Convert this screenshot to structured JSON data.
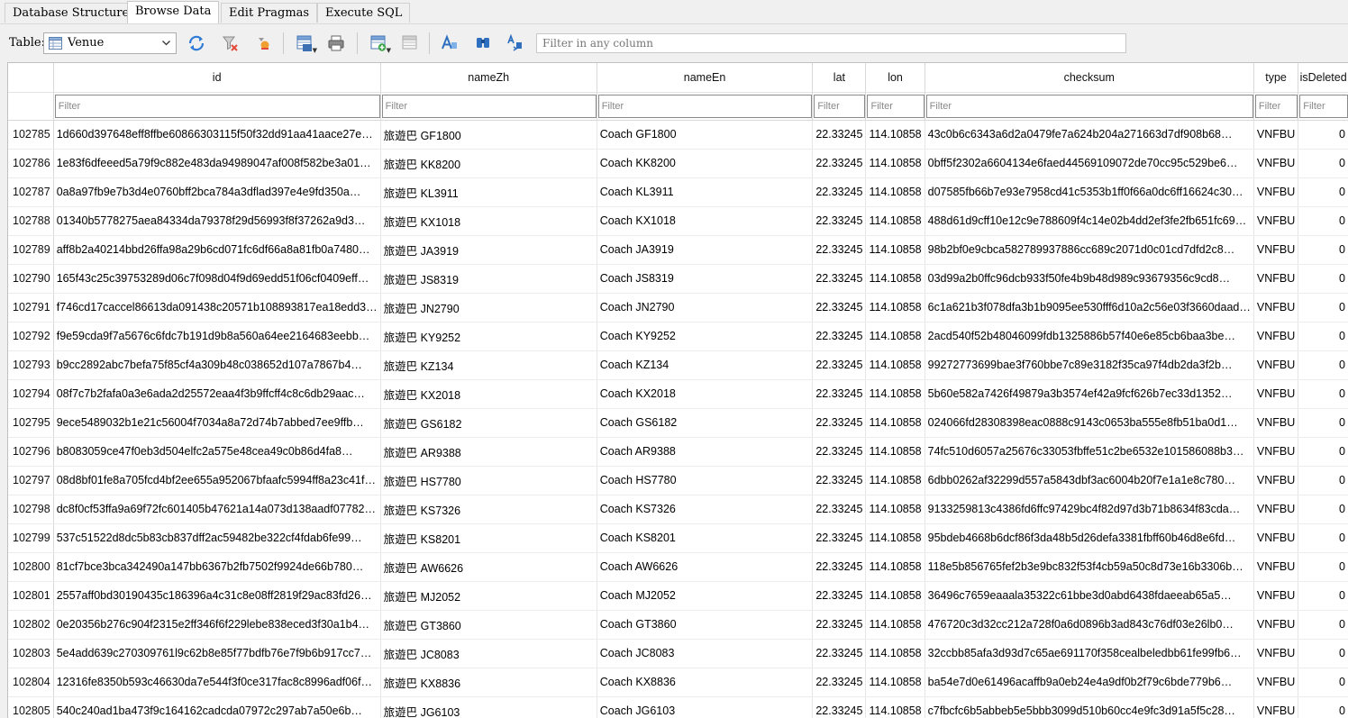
{
  "tabs": [
    {
      "label": "Database Structure",
      "active": false
    },
    {
      "label": "Browse Data",
      "active": true
    },
    {
      "label": "Edit Pragmas",
      "active": false
    },
    {
      "label": "Execute SQL",
      "active": false
    }
  ],
  "toolbar": {
    "table_label": "Table:",
    "selected_table": "Venue",
    "filter_placeholder": "Filter in any column"
  },
  "grid": {
    "columns": [
      "id",
      "nameZh",
      "nameEn",
      "lat",
      "lon",
      "checksum",
      "type",
      "isDeleted"
    ],
    "filter_placeholder": "Filter",
    "rows": [
      {
        "rowid": "102785",
        "id": "1d660d397648eff8ffbe60866303115f50f32dd91aa41aace27e…",
        "nameZh": "旅遊巴 GF1800",
        "nameEn": "Coach GF1800",
        "lat": "22.33245",
        "lon": "114.10858",
        "checksum": "43c0b6c6343a6d2a0479fe7a624b204a271663d7df908b68…",
        "type": "VNFBU",
        "isDeleted": "0"
      },
      {
        "rowid": "102786",
        "id": "1e83f6dfeeed5a79f9c882e483da94989047af008f582be3a01…",
        "nameZh": "旅遊巴 KK8200",
        "nameEn": "Coach KK8200",
        "lat": "22.33245",
        "lon": "114.10858",
        "checksum": "0bff5f2302a6604134e6faed44569109072de70cc95c529be6…",
        "type": "VNFBU",
        "isDeleted": "0"
      },
      {
        "rowid": "102787",
        "id": "0a8a97fb9e7b3d4e0760bff2bca784a3dflad397e4e9fd350a…",
        "nameZh": "旅遊巴 KL3911",
        "nameEn": "Coach KL3911",
        "lat": "22.33245",
        "lon": "114.10858",
        "checksum": "d07585fb66b7e93e7958cd41c5353b1ff0f66a0dc6ff16624c30…",
        "type": "VNFBU",
        "isDeleted": "0"
      },
      {
        "rowid": "102788",
        "id": "01340b5778275aea84334da79378f29d56993f8f37262a9d3…",
        "nameZh": "旅遊巴 KX1018",
        "nameEn": "Coach KX1018",
        "lat": "22.33245",
        "lon": "114.10858",
        "checksum": "488d61d9cff10e12c9e788609f4c14e02b4dd2ef3fe2fb651fc69…",
        "type": "VNFBU",
        "isDeleted": "0"
      },
      {
        "rowid": "102789",
        "id": "aff8b2a40214bbd26ffa98a29b6cd071fc6df66a8a81fb0a7480…",
        "nameZh": "旅遊巴 JA3919",
        "nameEn": "Coach JA3919",
        "lat": "22.33245",
        "lon": "114.10858",
        "checksum": "98b2bf0e9cbca582789937886cc689c2071d0c01cd7dfd2c8…",
        "type": "VNFBU",
        "isDeleted": "0"
      },
      {
        "rowid": "102790",
        "id": "165f43c25c39753289d06c7f098d04f9d69edd51f06cf0409eff…",
        "nameZh": "旅遊巴 JS8319",
        "nameEn": "Coach JS8319",
        "lat": "22.33245",
        "lon": "114.10858",
        "checksum": "03d99a2b0ffc96dcb933f50fe4b9b48d989c93679356c9cd8…",
        "type": "VNFBU",
        "isDeleted": "0"
      },
      {
        "rowid": "102791",
        "id": "f746cd17caccel86613da091438c20571b108893817ea18edd3…",
        "nameZh": "旅遊巴 JN2790",
        "nameEn": "Coach JN2790",
        "lat": "22.33245",
        "lon": "114.10858",
        "checksum": "6c1a621b3f078dfa3b1b9095ee530fff6d10a2c56e03f3660daad…",
        "type": "VNFBU",
        "isDeleted": "0"
      },
      {
        "rowid": "102792",
        "id": "f9e59cda9f7a5676c6fdc7b191d9b8a560a64ee2164683eebb…",
        "nameZh": "旅遊巴 KY9252",
        "nameEn": "Coach KY9252",
        "lat": "22.33245",
        "lon": "114.10858",
        "checksum": "2acd540f52b48046099fdb1325886b57f40e6e85cb6baa3be…",
        "type": "VNFBU",
        "isDeleted": "0"
      },
      {
        "rowid": "102793",
        "id": "b9cc2892abc7befa75f85cf4a309b48c038652d107a7867b4…",
        "nameZh": "旅遊巴 KZ134",
        "nameEn": "Coach KZ134",
        "lat": "22.33245",
        "lon": "114.10858",
        "checksum": "99272773699bae3f760bbe7c89e3182f35ca97f4db2da3f2b…",
        "type": "VNFBU",
        "isDeleted": "0"
      },
      {
        "rowid": "102794",
        "id": "08f7c7b2fafa0a3e6ada2d25572eaa4f3b9ffcff4c8c6db29aac…",
        "nameZh": "旅遊巴 KX2018",
        "nameEn": "Coach KX2018",
        "lat": "22.33245",
        "lon": "114.10858",
        "checksum": "5b60e582a7426f49879a3b3574ef42a9fcf626b7ec33d1352…",
        "type": "VNFBU",
        "isDeleted": "0"
      },
      {
        "rowid": "102795",
        "id": "9ece5489032b1e21c56004f7034a8a72d74b7abbed7ee9ffb…",
        "nameZh": "旅遊巴 GS6182",
        "nameEn": "Coach GS6182",
        "lat": "22.33245",
        "lon": "114.10858",
        "checksum": "024066fd28308398eac0888c9143c0653ba555e8fb51ba0d1…",
        "type": "VNFBU",
        "isDeleted": "0"
      },
      {
        "rowid": "102796",
        "id": "b8083059ce47f0eb3d504elfc2a575e48cea49c0b86d4fa8…",
        "nameZh": "旅遊巴 AR9388",
        "nameEn": "Coach AR9388",
        "lat": "22.33245",
        "lon": "114.10858",
        "checksum": "74fc510d6057a25676c33053fbffe51c2be6532e101586088b3…",
        "type": "VNFBU",
        "isDeleted": "0"
      },
      {
        "rowid": "102797",
        "id": "08d8bf01fe8a705fcd4bf2ee655a952067bfaafc5994ff8a23c41f…",
        "nameZh": "旅遊巴 HS7780",
        "nameEn": "Coach HS7780",
        "lat": "22.33245",
        "lon": "114.10858",
        "checksum": "6dbb0262af32299d557a5843dbf3ac6004b20f7e1a1e8c780…",
        "type": "VNFBU",
        "isDeleted": "0"
      },
      {
        "rowid": "102798",
        "id": "dc8f0cf53ffa9a69f72fc601405b47621a14a073d138aadf07782…",
        "nameZh": "旅遊巴 KS7326",
        "nameEn": "Coach KS7326",
        "lat": "22.33245",
        "lon": "114.10858",
        "checksum": "9133259813c4386fd6ffc97429bc4f82d97d3b71b8634f83cda…",
        "type": "VNFBU",
        "isDeleted": "0"
      },
      {
        "rowid": "102799",
        "id": "537c51522d8dc5b83cb837dff2ac59482be322cf4fdab6fe99…",
        "nameZh": "旅遊巴 KS8201",
        "nameEn": "Coach KS8201",
        "lat": "22.33245",
        "lon": "114.10858",
        "checksum": "95bdeb4668b6dcf86f3da48b5d26defa3381fbff60b46d8e6fd…",
        "type": "VNFBU",
        "isDeleted": "0"
      },
      {
        "rowid": "102800",
        "id": "81cf7bce3bca342490a147bb6367b2fb7502f9924de66b780…",
        "nameZh": "旅遊巴 AW6626",
        "nameEn": "Coach AW6626",
        "lat": "22.33245",
        "lon": "114.10858",
        "checksum": "118e5b856765fef2b3e9bc832f53f4cb59a50c8d73e16b3306b…",
        "type": "VNFBU",
        "isDeleted": "0"
      },
      {
        "rowid": "102801",
        "id": "2557aff0bd30190435c186396a4c31c8e08ff2819f29ac83fd26…",
        "nameZh": "旅遊巴 MJ2052",
        "nameEn": "Coach MJ2052",
        "lat": "22.33245",
        "lon": "114.10858",
        "checksum": "36496c7659eaaala35322c61bbe3d0abd6438fdaeeab65a5…",
        "type": "VNFBU",
        "isDeleted": "0"
      },
      {
        "rowid": "102802",
        "id": "0e20356b276c904f2315e2ff346f6f229lebe838eced3f30a1b4…",
        "nameZh": "旅遊巴 GT3860",
        "nameEn": "Coach GT3860",
        "lat": "22.33245",
        "lon": "114.10858",
        "checksum": "476720c3d32cc212a728f0a6d0896b3ad843c76df03e26lb0…",
        "type": "VNFBU",
        "isDeleted": "0"
      },
      {
        "rowid": "102803",
        "id": "5e4add639c270309761l9c62b8e85f77bdfb76e7f9b6b917cc7…",
        "nameZh": "旅遊巴 JC8083",
        "nameEn": "Coach JC8083",
        "lat": "22.33245",
        "lon": "114.10858",
        "checksum": "32ccbb85afa3d93d7c65ae691170f358cealbeledbb61fe99fb6…",
        "type": "VNFBU",
        "isDeleted": "0"
      },
      {
        "rowid": "102804",
        "id": "12316fe8350b593c46630da7e544f3f0ce317fac8c8996adf06f…",
        "nameZh": "旅遊巴 KX8836",
        "nameEn": "Coach KX8836",
        "lat": "22.33245",
        "lon": "114.10858",
        "checksum": "ba54e7d0e61496acaffb9a0eb24e4a9df0b2f79c6bde779b6…",
        "type": "VNFBU",
        "isDeleted": "0"
      },
      {
        "rowid": "102805",
        "id": "540c240ad1ba473f9c164162cadcda07972c297ab7a50e6b…",
        "nameZh": "旅遊巴 JG6103",
        "nameEn": "Coach JG6103",
        "lat": "22.33245",
        "lon": "114.10858",
        "checksum": "c7fbcfc6b5abbeb5e5bbb3099d510b60cc4e9fc3d91a5f5c28…",
        "type": "VNFBU",
        "isDeleted": "0"
      }
    ]
  }
}
